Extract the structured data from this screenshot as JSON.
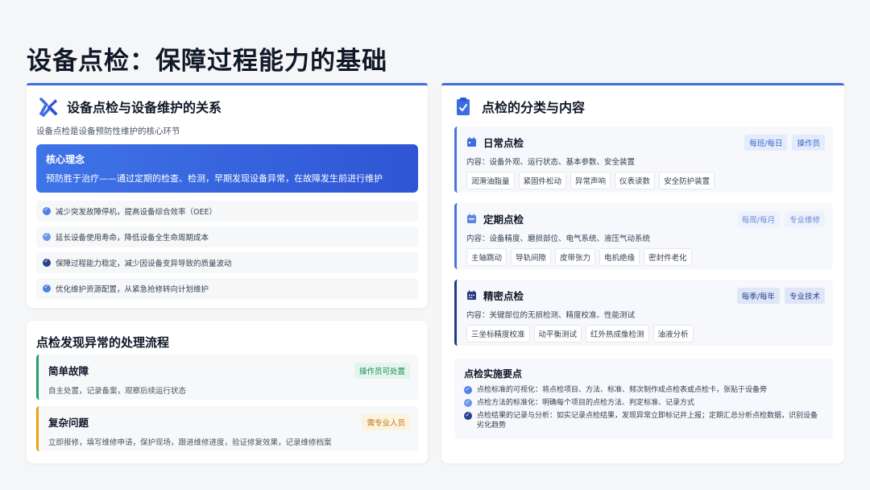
{
  "page": {
    "title": "设备点检：保障过程能力的基础"
  },
  "relation": {
    "title": "设备点检与设备维护的关系",
    "subtitle": "设备点检是设备预防性维护的核心环节",
    "core_heading": "核心理念",
    "core_text": "预防胜于治疗——通过定期的检查、检测，早期发现设备异常，在故障发生前进行维护",
    "bullets": [
      "减少突发故障停机，提高设备综合效率（OEE）",
      "延长设备使用寿命，降低设备全生命周期成本",
      "保障过程能力稳定，减少因设备变异导致的质量波动",
      "优化维护资源配置，从紧急抢修转向计划维护"
    ]
  },
  "process": {
    "title": "点检发现异常的处理流程",
    "items": [
      {
        "heading": "简单故障",
        "text": "自主处置，记录备案，观察后续运行状态",
        "tag": "操作员可处置"
      },
      {
        "heading": "复杂问题",
        "text": "立即报修，填写维修申请，保护现场，跟进维修进度，验证修复效果，记录维修档案",
        "tag": "需专业人员"
      }
    ]
  },
  "classification": {
    "title": "点检的分类与内容",
    "types": [
      {
        "heading": "日常点检",
        "tag1": "每班/每日",
        "tag2": "操作员",
        "content": "内容：设备外观、运行状态、基本参数、安全装置",
        "items": [
          "润滑油脂量",
          "紧固件松动",
          "异常声响",
          "仪表读数",
          "安全防护装置"
        ]
      },
      {
        "heading": "定期点检",
        "tag1": "每周/每月",
        "tag2": "专业维修",
        "content": "内容：设备精度、磨损部位、电气系统、液压气动系统",
        "items": [
          "主轴跳动",
          "导轨间隙",
          "皮带张力",
          "电机绝缘",
          "密封件老化"
        ]
      },
      {
        "heading": "精密点检",
        "tag1": "每季/每年",
        "tag2": "专业技术",
        "content": "内容：关键部位的无损检测、精度校准、性能测试",
        "items": [
          "三坐标精度校准",
          "动平衡测试",
          "红外热成像检测",
          "油液分析"
        ]
      }
    ],
    "impl_title": "点检实施要点",
    "impl_points": [
      "点检标准的可视化：将点检项目、方法、标准、频次制作成点检表或点检卡，张贴于设备旁",
      "点检方法的标准化：明确每个项目的点检方法、判定标准、记录方式",
      "点检结果的记录与分析：如实记录点检结果，发现异常立即标记并上报；定期汇总分析点检数据，识别设备劣化趋势"
    ]
  },
  "colors": {
    "accent": "#3b6fe0",
    "green": "#22a06b",
    "orange": "#e8a317",
    "dark_blue": "#223a88"
  }
}
